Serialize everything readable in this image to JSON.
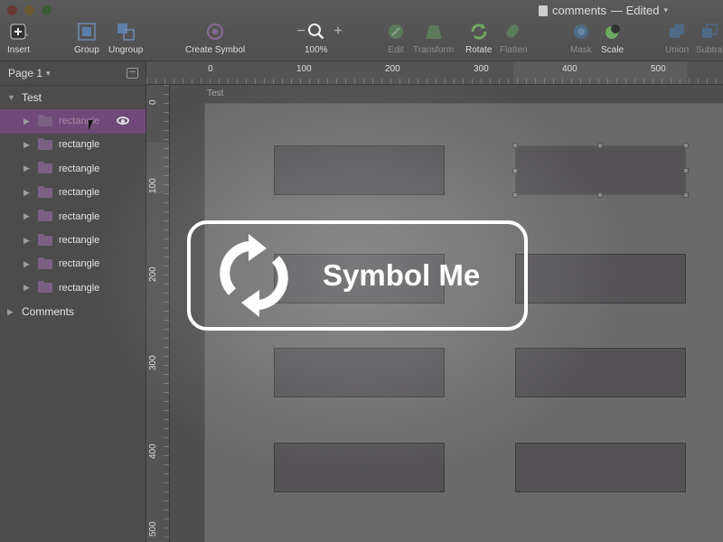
{
  "window": {
    "title": "comments",
    "status": "— Edited"
  },
  "toolbar": {
    "insert": "Insert",
    "group": "Group",
    "ungroup": "Ungroup",
    "create_symbol": "Create Symbol",
    "zoom_minus": "−",
    "zoom_plus": "+",
    "zoom_level": "100%",
    "edit": "Edit",
    "transform": "Transform",
    "rotate": "Rotate",
    "flatten": "Flatten",
    "mask": "Mask",
    "scale": "Scale",
    "union": "Union",
    "subtract": "Subtra"
  },
  "layers": {
    "page": "Page 1",
    "group_name": "Test",
    "items": [
      {
        "name": "rectangle"
      },
      {
        "name": "rectangle"
      },
      {
        "name": "rectangle"
      },
      {
        "name": "rectangle"
      },
      {
        "name": "rectangle"
      },
      {
        "name": "rectangle"
      },
      {
        "name": "rectangle"
      },
      {
        "name": "rectangle"
      }
    ],
    "comments": "Comments"
  },
  "ruler": {
    "h_labels": [
      "0",
      "100",
      "200",
      "300",
      "400",
      "500"
    ],
    "v_labels": [
      "0",
      "100",
      "200",
      "300",
      "400",
      "500"
    ]
  },
  "canvas": {
    "artboard_name": "Test"
  },
  "overlay": {
    "text": "Symbol Me",
    "icon": "refresh-icon"
  },
  "colors": {
    "selection": "#6f4a78",
    "background": "#4a4a4a"
  }
}
